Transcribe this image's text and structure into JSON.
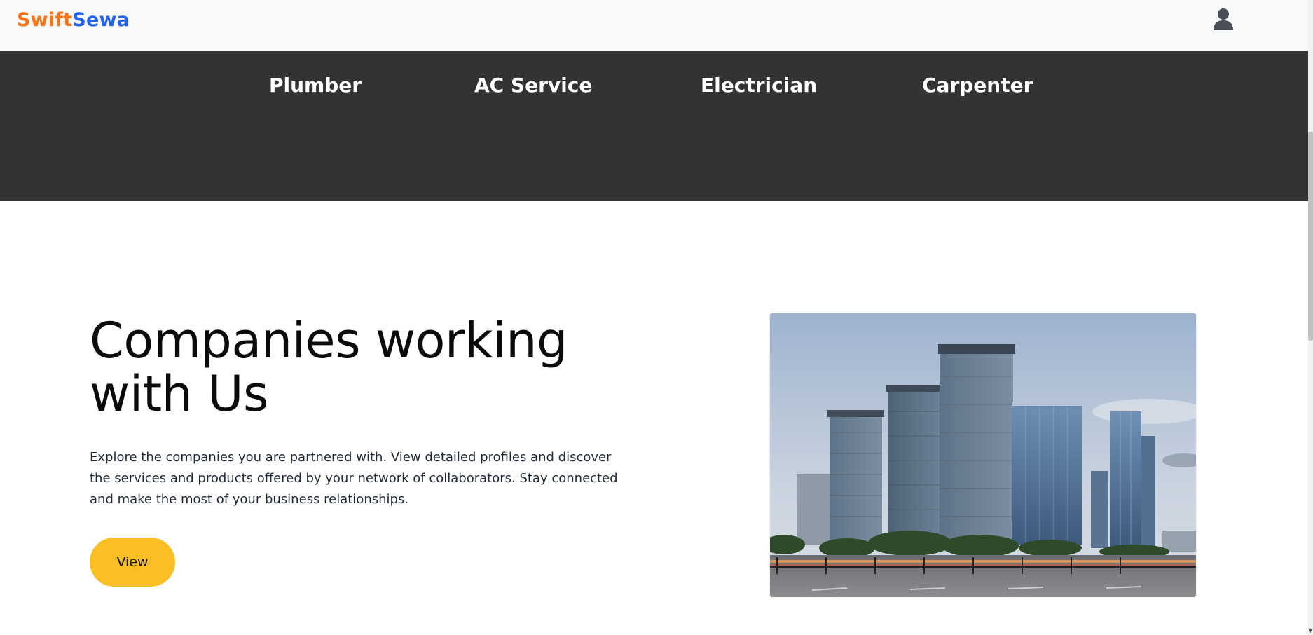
{
  "header": {
    "brand_part1": "Swift",
    "brand_part2": "Sewa",
    "brand_colors": {
      "part1": "#f97316",
      "part2": "#2563eb"
    },
    "user_icon": "user-icon"
  },
  "services": {
    "items": [
      {
        "label": "Plumber"
      },
      {
        "label": "AC Service"
      },
      {
        "label": "Electrician"
      },
      {
        "label": "Carpenter"
      }
    ],
    "band_color": "#333333"
  },
  "hero": {
    "title": "Companies working with Us",
    "description": "Explore the companies you are partnered with. View detailed profiles and discover the services and products offered by your network of collaborators. Stay connected and make the most of your business relationships.",
    "button_label": "View",
    "button_color": "#fbbf24",
    "image": "city-skyline-image"
  }
}
